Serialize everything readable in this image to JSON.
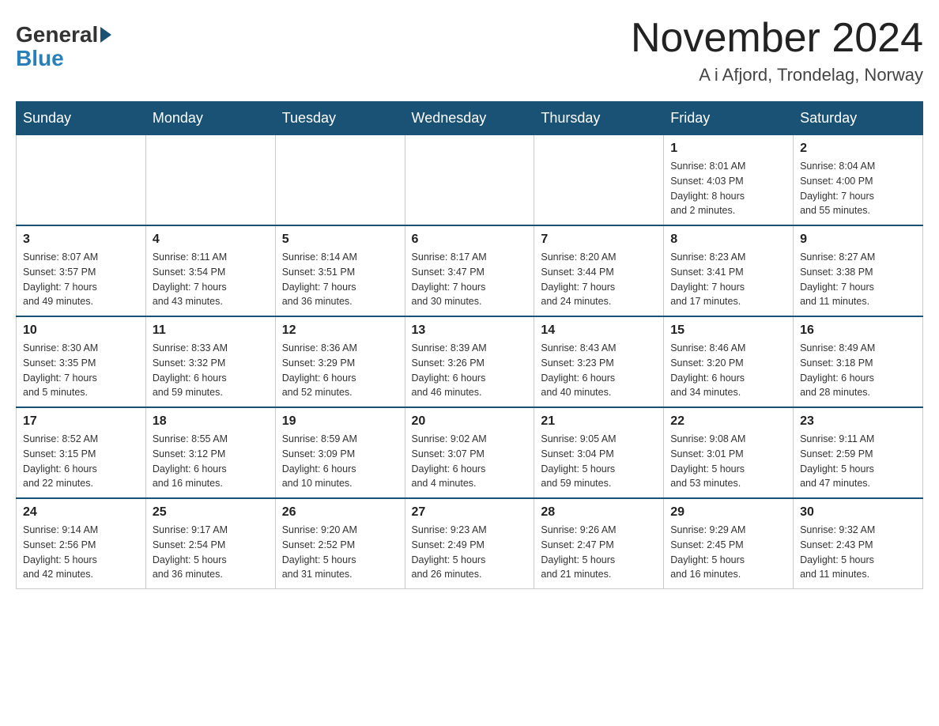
{
  "header": {
    "logo_general": "General",
    "logo_blue": "Blue",
    "title": "November 2024",
    "location": "A i Afjord, Trondelag, Norway"
  },
  "days_of_week": [
    "Sunday",
    "Monday",
    "Tuesday",
    "Wednesday",
    "Thursday",
    "Friday",
    "Saturday"
  ],
  "weeks": [
    [
      {
        "day": "",
        "info": ""
      },
      {
        "day": "",
        "info": ""
      },
      {
        "day": "",
        "info": ""
      },
      {
        "day": "",
        "info": ""
      },
      {
        "day": "",
        "info": ""
      },
      {
        "day": "1",
        "info": "Sunrise: 8:01 AM\nSunset: 4:03 PM\nDaylight: 8 hours\nand 2 minutes."
      },
      {
        "day": "2",
        "info": "Sunrise: 8:04 AM\nSunset: 4:00 PM\nDaylight: 7 hours\nand 55 minutes."
      }
    ],
    [
      {
        "day": "3",
        "info": "Sunrise: 8:07 AM\nSunset: 3:57 PM\nDaylight: 7 hours\nand 49 minutes."
      },
      {
        "day": "4",
        "info": "Sunrise: 8:11 AM\nSunset: 3:54 PM\nDaylight: 7 hours\nand 43 minutes."
      },
      {
        "day": "5",
        "info": "Sunrise: 8:14 AM\nSunset: 3:51 PM\nDaylight: 7 hours\nand 36 minutes."
      },
      {
        "day": "6",
        "info": "Sunrise: 8:17 AM\nSunset: 3:47 PM\nDaylight: 7 hours\nand 30 minutes."
      },
      {
        "day": "7",
        "info": "Sunrise: 8:20 AM\nSunset: 3:44 PM\nDaylight: 7 hours\nand 24 minutes."
      },
      {
        "day": "8",
        "info": "Sunrise: 8:23 AM\nSunset: 3:41 PM\nDaylight: 7 hours\nand 17 minutes."
      },
      {
        "day": "9",
        "info": "Sunrise: 8:27 AM\nSunset: 3:38 PM\nDaylight: 7 hours\nand 11 minutes."
      }
    ],
    [
      {
        "day": "10",
        "info": "Sunrise: 8:30 AM\nSunset: 3:35 PM\nDaylight: 7 hours\nand 5 minutes."
      },
      {
        "day": "11",
        "info": "Sunrise: 8:33 AM\nSunset: 3:32 PM\nDaylight: 6 hours\nand 59 minutes."
      },
      {
        "day": "12",
        "info": "Sunrise: 8:36 AM\nSunset: 3:29 PM\nDaylight: 6 hours\nand 52 minutes."
      },
      {
        "day": "13",
        "info": "Sunrise: 8:39 AM\nSunset: 3:26 PM\nDaylight: 6 hours\nand 46 minutes."
      },
      {
        "day": "14",
        "info": "Sunrise: 8:43 AM\nSunset: 3:23 PM\nDaylight: 6 hours\nand 40 minutes."
      },
      {
        "day": "15",
        "info": "Sunrise: 8:46 AM\nSunset: 3:20 PM\nDaylight: 6 hours\nand 34 minutes."
      },
      {
        "day": "16",
        "info": "Sunrise: 8:49 AM\nSunset: 3:18 PM\nDaylight: 6 hours\nand 28 minutes."
      }
    ],
    [
      {
        "day": "17",
        "info": "Sunrise: 8:52 AM\nSunset: 3:15 PM\nDaylight: 6 hours\nand 22 minutes."
      },
      {
        "day": "18",
        "info": "Sunrise: 8:55 AM\nSunset: 3:12 PM\nDaylight: 6 hours\nand 16 minutes."
      },
      {
        "day": "19",
        "info": "Sunrise: 8:59 AM\nSunset: 3:09 PM\nDaylight: 6 hours\nand 10 minutes."
      },
      {
        "day": "20",
        "info": "Sunrise: 9:02 AM\nSunset: 3:07 PM\nDaylight: 6 hours\nand 4 minutes."
      },
      {
        "day": "21",
        "info": "Sunrise: 9:05 AM\nSunset: 3:04 PM\nDaylight: 5 hours\nand 59 minutes."
      },
      {
        "day": "22",
        "info": "Sunrise: 9:08 AM\nSunset: 3:01 PM\nDaylight: 5 hours\nand 53 minutes."
      },
      {
        "day": "23",
        "info": "Sunrise: 9:11 AM\nSunset: 2:59 PM\nDaylight: 5 hours\nand 47 minutes."
      }
    ],
    [
      {
        "day": "24",
        "info": "Sunrise: 9:14 AM\nSunset: 2:56 PM\nDaylight: 5 hours\nand 42 minutes."
      },
      {
        "day": "25",
        "info": "Sunrise: 9:17 AM\nSunset: 2:54 PM\nDaylight: 5 hours\nand 36 minutes."
      },
      {
        "day": "26",
        "info": "Sunrise: 9:20 AM\nSunset: 2:52 PM\nDaylight: 5 hours\nand 31 minutes."
      },
      {
        "day": "27",
        "info": "Sunrise: 9:23 AM\nSunset: 2:49 PM\nDaylight: 5 hours\nand 26 minutes."
      },
      {
        "day": "28",
        "info": "Sunrise: 9:26 AM\nSunset: 2:47 PM\nDaylight: 5 hours\nand 21 minutes."
      },
      {
        "day": "29",
        "info": "Sunrise: 9:29 AM\nSunset: 2:45 PM\nDaylight: 5 hours\nand 16 minutes."
      },
      {
        "day": "30",
        "info": "Sunrise: 9:32 AM\nSunset: 2:43 PM\nDaylight: 5 hours\nand 11 minutes."
      }
    ]
  ]
}
